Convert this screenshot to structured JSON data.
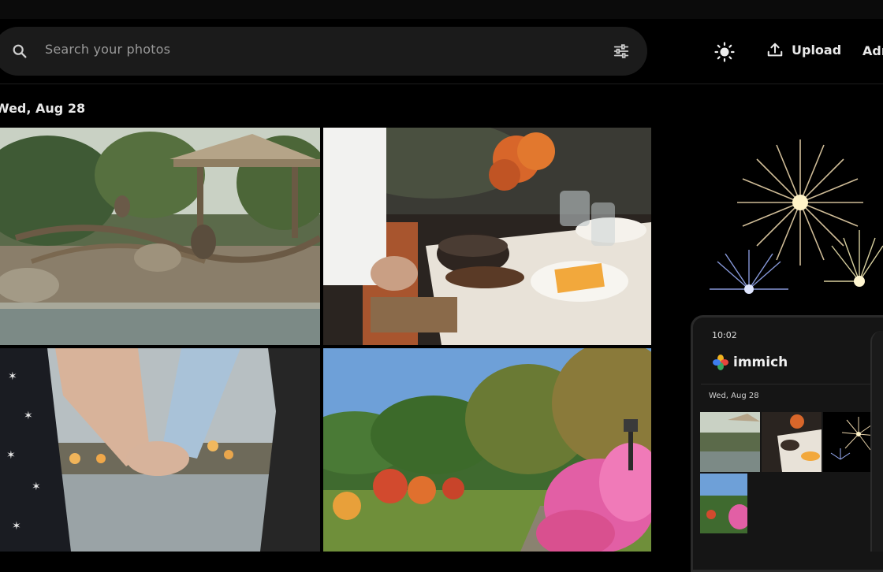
{
  "search": {
    "placeholder": "Search your photos"
  },
  "header": {
    "upload_label": "Upload",
    "admin_label": "Adm"
  },
  "timeline": {
    "date_label": "Wed, Aug 28"
  },
  "phone": {
    "status_time": "10:02",
    "app_name": "immich",
    "date_label": "Wed, Aug 28"
  },
  "colors": {
    "background": "#000000",
    "search_bg": "#1b1b1b",
    "text": "#e8e8e8",
    "muted": "#9a9a9a"
  },
  "icons": [
    "search-icon",
    "tune-icon",
    "theme-sun-icon",
    "upload-icon",
    "immich-logo-icon"
  ]
}
